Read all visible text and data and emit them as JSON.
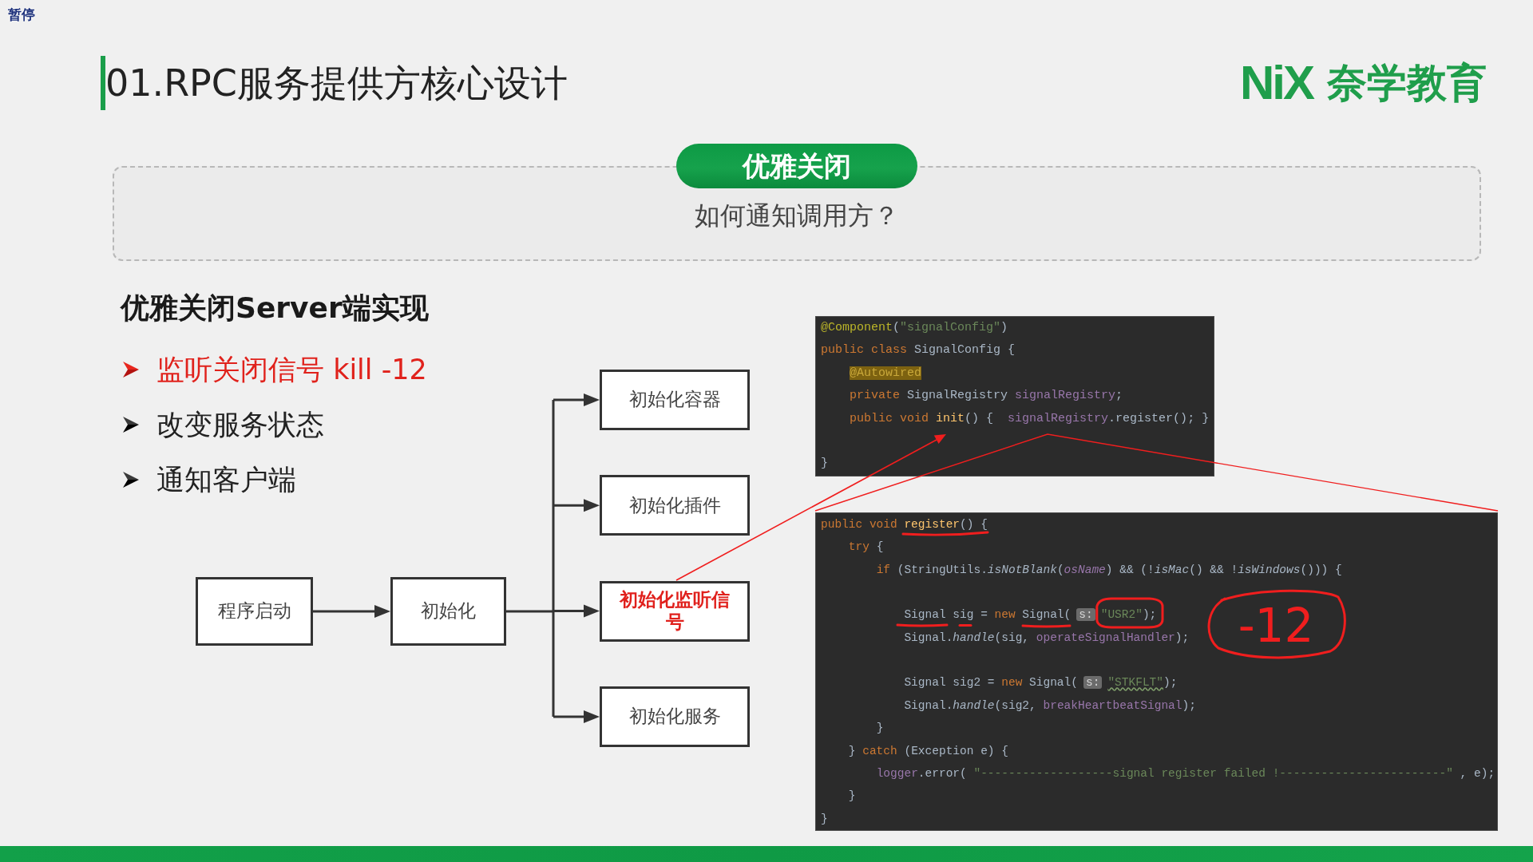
{
  "player_label": "暂停",
  "header": {
    "title": "01.RPC服务提供方核心设计",
    "logo": {
      "mark": "NiX",
      "name": "奈学教育"
    }
  },
  "banner": {
    "tag": "优雅关闭",
    "question": "如何通知调用方？"
  },
  "section": {
    "heading": "优雅关闭Server端实现",
    "bullets": [
      {
        "text": "监听关闭信号 kill -12",
        "highlighted": true
      },
      {
        "text": "改变服务状态",
        "highlighted": false
      },
      {
        "text": "通知客户端",
        "highlighted": false
      }
    ]
  },
  "flowchart": {
    "steps": [
      {
        "label": "程序启动"
      },
      {
        "label": "初始化"
      }
    ],
    "branches": [
      {
        "label": "初始化容器",
        "highlighted": false
      },
      {
        "label": "初始化插件",
        "highlighted": false
      },
      {
        "label": "初始化监听信号",
        "highlighted": true
      },
      {
        "label": "初始化服务",
        "highlighted": false
      }
    ]
  },
  "code_panels": [
    {
      "lines": [
        {
          "kind": "code",
          "tokens": [
            {
              "kind": "annotation",
              "text": "@Component"
            },
            {
              "kind": "plain",
              "text": "("
            },
            {
              "kind": "string",
              "text": "\"signalConfig\""
            },
            {
              "kind": "plain",
              "text": ")"
            }
          ]
        },
        {
          "kind": "code",
          "tokens": [
            {
              "kind": "keyword",
              "text": "public class"
            },
            {
              "kind": "plain",
              "text": " SignalConfig {"
            }
          ]
        },
        {
          "kind": "code",
          "tokens": [
            {
              "kind": "annotation-marked",
              "text": "    @Autowired"
            }
          ]
        },
        {
          "kind": "code",
          "tokens": [
            {
              "kind": "keyword",
              "text": "    private"
            },
            {
              "kind": "plain",
              "text": " SignalRegistry "
            },
            {
              "kind": "field",
              "text": "signalRegistry"
            },
            {
              "kind": "plain",
              "text": ";"
            }
          ]
        },
        {
          "kind": "code",
          "tokens": [
            {
              "kind": "keyword",
              "text": "    public void "
            },
            {
              "kind": "method",
              "text": "init"
            },
            {
              "kind": "plain",
              "text": "() {  "
            },
            {
              "kind": "field",
              "text": "signalRegistry"
            },
            {
              "kind": "plain",
              "text": ".register(); }"
            }
          ]
        },
        {
          "kind": "blank"
        },
        {
          "kind": "code",
          "tokens": [
            {
              "kind": "plain",
              "text": "}"
            }
          ]
        }
      ]
    },
    {
      "lines": [
        {
          "kind": "code",
          "tokens": [
            {
              "kind": "keyword",
              "text": "public void "
            },
            {
              "kind": "method",
              "text": "register"
            },
            {
              "kind": "plain",
              "text": "() {"
            }
          ]
        },
        {
          "kind": "code",
          "tokens": [
            {
              "kind": "keyword",
              "text": "    try"
            },
            {
              "kind": "plain",
              "text": " {"
            }
          ]
        },
        {
          "kind": "code",
          "tokens": [
            {
              "kind": "keyword",
              "text": "        if"
            },
            {
              "kind": "plain",
              "text": " (StringUtils."
            },
            {
              "kind": "call-italic",
              "text": "isNotBlank"
            },
            {
              "kind": "plain",
              "text": "("
            },
            {
              "kind": "field-italic",
              "text": "osName"
            },
            {
              "kind": "plain",
              "text": ") && (!"
            },
            {
              "kind": "call-italic",
              "text": "isMac"
            },
            {
              "kind": "plain",
              "text": "() && !"
            },
            {
              "kind": "call-italic",
              "text": "isWindows"
            },
            {
              "kind": "plain",
              "text": "())) {"
            }
          ]
        },
        {
          "kind": "blank"
        },
        {
          "kind": "code",
          "tokens": [
            {
              "kind": "plain",
              "text": "            Signal sig = "
            },
            {
              "kind": "keyword",
              "text": "new"
            },
            {
              "kind": "plain",
              "text": " Signal("
            },
            {
              "kind": "hint",
              "text": "s:"
            },
            {
              "kind": "string",
              "text": "\"USR2\""
            },
            {
              "kind": "plain",
              "text": ");"
            }
          ]
        },
        {
          "kind": "code",
          "tokens": [
            {
              "kind": "plain",
              "text": "            Signal."
            },
            {
              "kind": "call-italic",
              "text": "handle"
            },
            {
              "kind": "plain",
              "text": "(sig, "
            },
            {
              "kind": "field",
              "text": "operateSignalHandler"
            },
            {
              "kind": "plain",
              "text": ");"
            }
          ]
        },
        {
          "kind": "blank"
        },
        {
          "kind": "code",
          "tokens": [
            {
              "kind": "plain",
              "text": "            Signal sig2 = "
            },
            {
              "kind": "keyword",
              "text": "new"
            },
            {
              "kind": "plain",
              "text": " Signal("
            },
            {
              "kind": "hint",
              "text": "s:"
            },
            {
              "kind": "string-flagged",
              "text": "\"STKFLT\""
            },
            {
              "kind": "plain",
              "text": ");"
            }
          ]
        },
        {
          "kind": "code",
          "tokens": [
            {
              "kind": "plain",
              "text": "            Signal."
            },
            {
              "kind": "call-italic",
              "text": "handle"
            },
            {
              "kind": "plain",
              "text": "(sig2, "
            },
            {
              "kind": "field",
              "text": "breakHeartbeatSignal"
            },
            {
              "kind": "plain",
              "text": ");"
            }
          ]
        },
        {
          "kind": "code",
          "tokens": [
            {
              "kind": "plain",
              "text": "        }"
            }
          ]
        },
        {
          "kind": "code",
          "tokens": [
            {
              "kind": "plain",
              "text": "    } "
            },
            {
              "kind": "keyword",
              "text": "catch"
            },
            {
              "kind": "plain",
              "text": " (Exception e) {"
            }
          ]
        },
        {
          "kind": "code",
          "tokens": [
            {
              "kind": "field",
              "text": "        logger"
            },
            {
              "kind": "plain",
              "text": ".error( "
            },
            {
              "kind": "string",
              "text": "\"-------------------signal register failed !------------------------\""
            },
            {
              "kind": "plain",
              "text": " , e);"
            }
          ]
        },
        {
          "kind": "code",
          "tokens": [
            {
              "kind": "plain",
              "text": "    }"
            }
          ]
        },
        {
          "kind": "code",
          "tokens": [
            {
              "kind": "plain",
              "text": "}"
            }
          ]
        }
      ]
    }
  ],
  "annotations": {
    "note": "-12"
  }
}
